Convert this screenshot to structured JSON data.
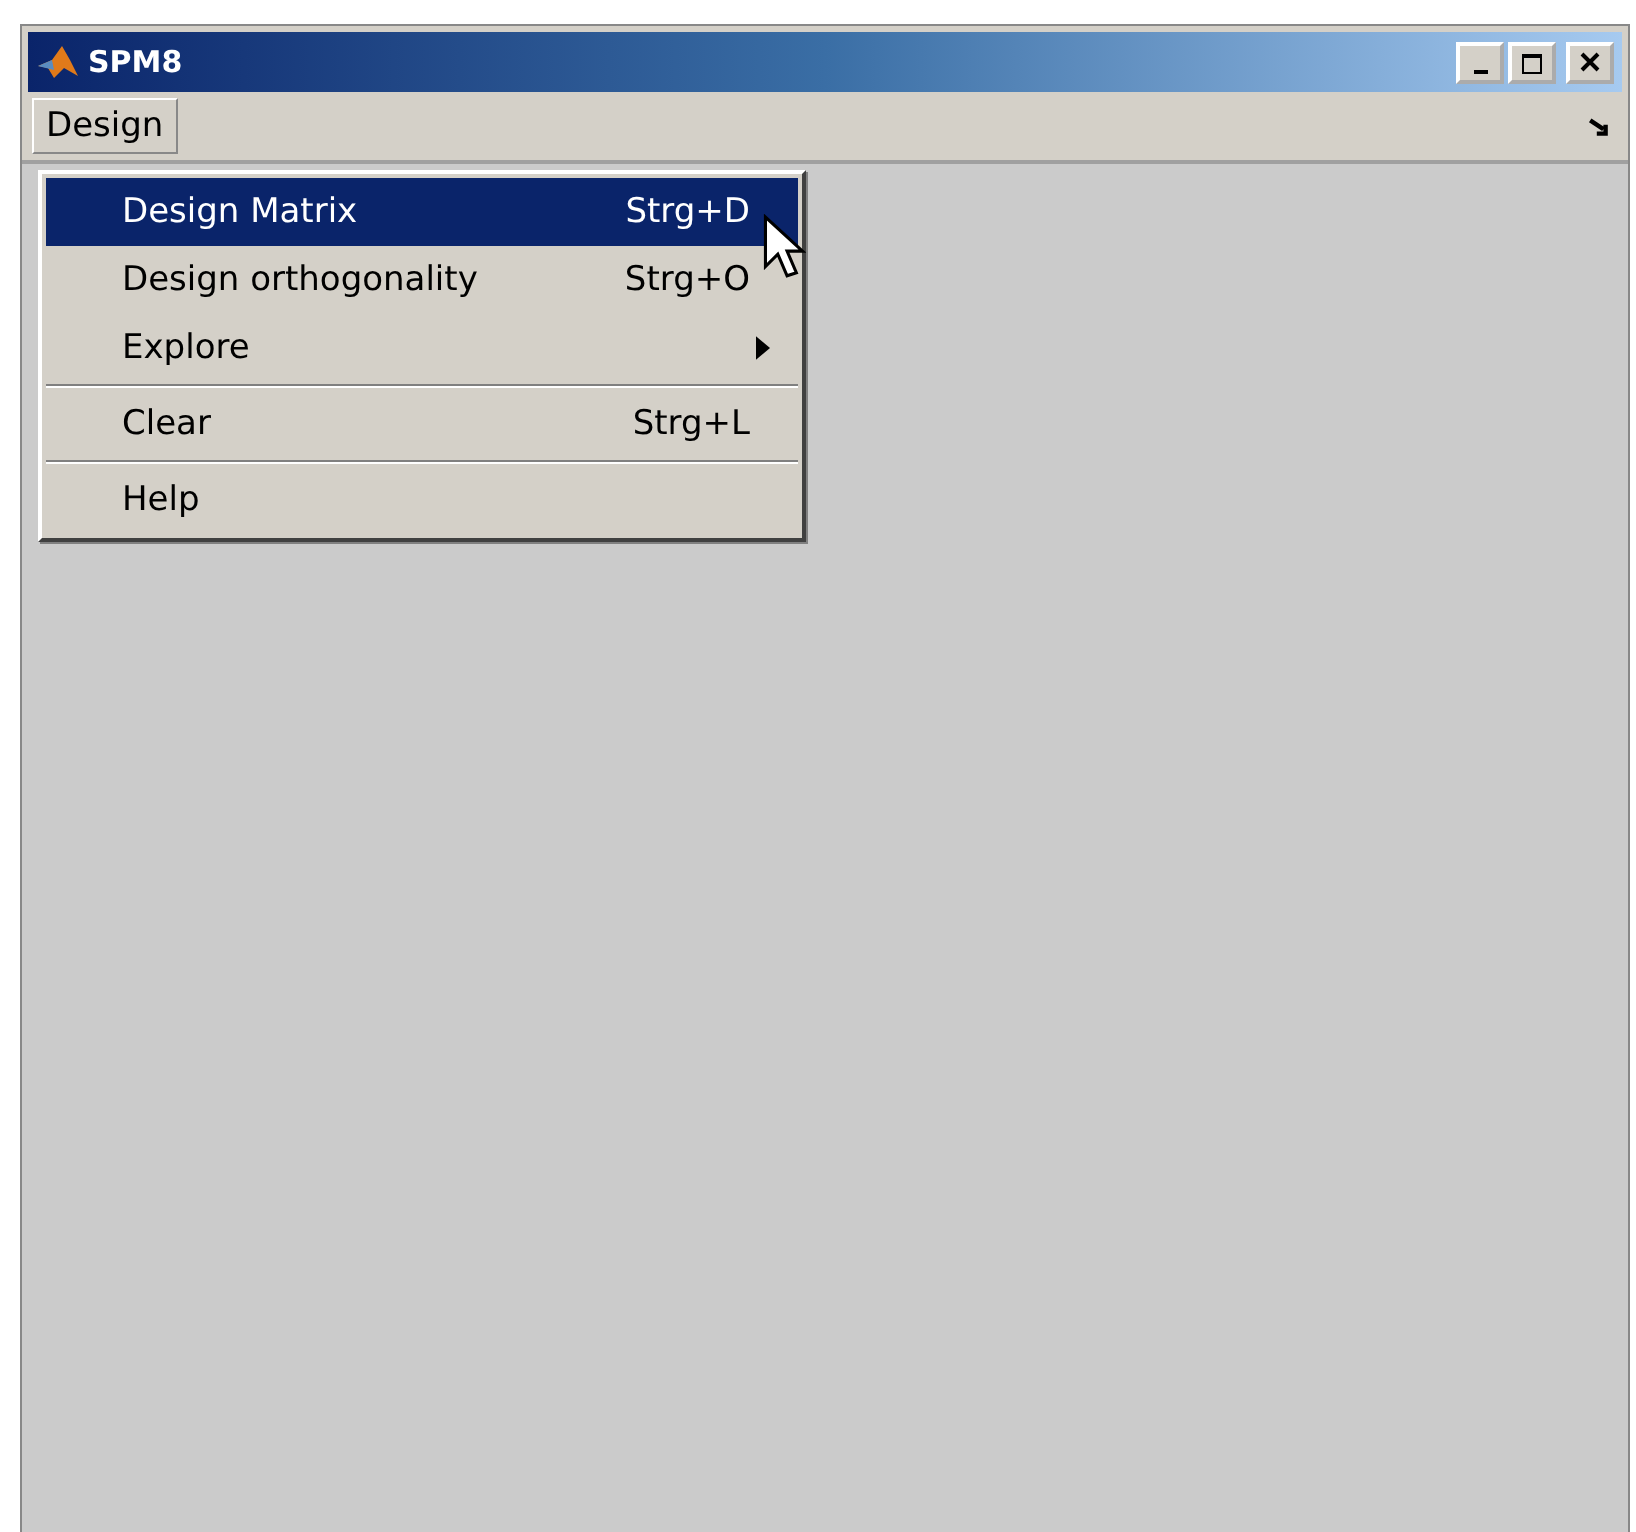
{
  "window": {
    "title": "SPM8"
  },
  "menubar": [
    {
      "label": "Design",
      "selected": true
    }
  ],
  "menu": {
    "items": [
      {
        "label": "Design Matrix",
        "shortcut": "Strg+D",
        "selected": true,
        "submenu": false,
        "separator_above": false
      },
      {
        "label": "Design orthogonality",
        "shortcut": "Strg+O",
        "selected": false,
        "submenu": false,
        "separator_above": false
      },
      {
        "label": "Explore",
        "selected": false,
        "submenu": true,
        "separator_above": false
      },
      {
        "label": "Clear",
        "shortcut": "Strg+L",
        "selected": false,
        "submenu": false,
        "separator_above": true
      },
      {
        "label": "Help",
        "selected": false,
        "submenu": false,
        "separator_above": true
      }
    ]
  }
}
